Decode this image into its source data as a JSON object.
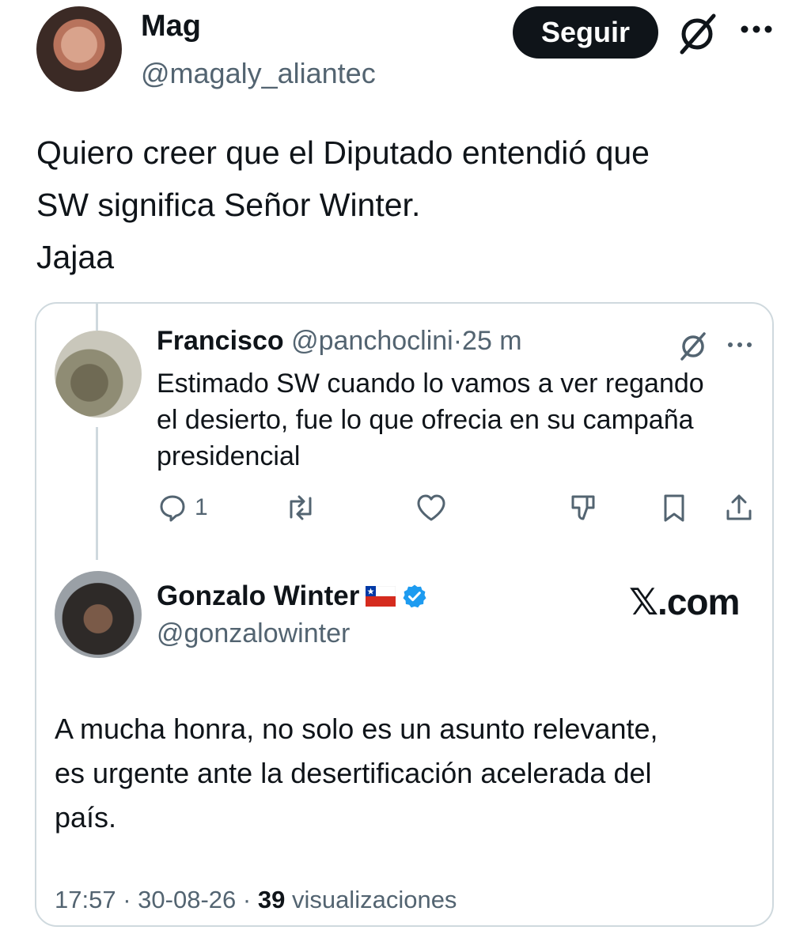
{
  "post": {
    "author_name": "Mag",
    "author_handle": "@magaly_aliantec",
    "follow_label": "Seguir",
    "text_lines": [
      "Quiero creer que el Diputado entendió que",
      "SW significa Señor Winter.",
      "Jajaa"
    ]
  },
  "quoted_reply": {
    "author_name": "Francisco",
    "author_handle": "@panchoclini",
    "separator": "·",
    "time": "25 m",
    "text_lines": [
      "Estimado SW cuando lo vamos a ver regando",
      "el desierto, fue lo que ofrecia en su campaña",
      "presidencial"
    ],
    "reply_count": "1"
  },
  "quoted_post": {
    "author_name": "Gonzalo Winter",
    "author_handle": "@gonzalowinter",
    "watermark": "𝕏.com",
    "text_lines": [
      "A mucha honra, no solo es un asunto relevante,",
      "es urgente ante la desertificación acelerada del",
      "país."
    ],
    "time": "17:57",
    "date": "30-08-26",
    "views_count": "39",
    "views_label": "visualizaciones"
  },
  "colors": {
    "text": "#0f1419",
    "muted": "#536471",
    "border": "#cfd9de",
    "verified": "#1d9bf0",
    "follow_bg": "#0f1419"
  },
  "icons": [
    "grok-icon",
    "more-icon",
    "reply-icon",
    "retweet-icon",
    "like-icon",
    "dislike-icon",
    "bookmark-icon",
    "share-icon",
    "chile-flag-icon",
    "verified-badge-icon"
  ]
}
